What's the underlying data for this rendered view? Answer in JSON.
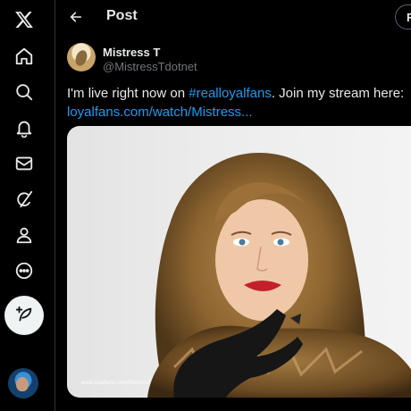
{
  "nav": {
    "items": [
      {
        "name": "x-logo-icon"
      },
      {
        "name": "home-icon"
      },
      {
        "name": "search-icon"
      },
      {
        "name": "notifications-bell-icon"
      },
      {
        "name": "messages-envelope-icon"
      },
      {
        "name": "grok-icon"
      },
      {
        "name": "profile-person-icon"
      },
      {
        "name": "more-circle-icon"
      }
    ],
    "compose_icon": "feather-plus-icon"
  },
  "header": {
    "title": "Post",
    "right_button_label": "R"
  },
  "post": {
    "author_name": "Mistress T",
    "author_handle": "@MistressTdotnet",
    "text_prefix": "I'm live right now on ",
    "hashtag": "#realloyalfans",
    "text_suffix": ". Join my stream here:",
    "link": "loyalfans.com/watch/Mistress...",
    "media_watermark": "www.loyalfans.com/MistressT"
  },
  "colors": {
    "background": "#000000",
    "text": "#e7e9ea",
    "muted": "#71767b",
    "link": "#1d9bf0",
    "border": "#2f3336"
  }
}
